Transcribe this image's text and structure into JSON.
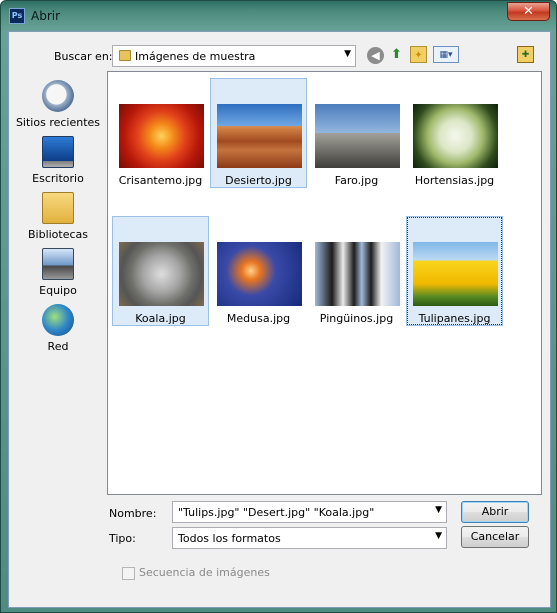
{
  "window": {
    "title": "Abrir",
    "app_icon": "Ps",
    "close_glyph": "✕"
  },
  "toolbar": {
    "lookin_label": "Buscar en:",
    "lookin_value": "Imágenes de muestra",
    "dropdown_glyph": "▼",
    "icons": [
      "back-icon",
      "up-folder-icon",
      "new-folder-icon",
      "view-menu-icon",
      "pin-icon"
    ]
  },
  "places": [
    {
      "label": "Sitios recientes",
      "icon": "recent-places-icon"
    },
    {
      "label": "Escritorio",
      "icon": "desktop-icon"
    },
    {
      "label": "Bibliotecas",
      "icon": "libraries-icon"
    },
    {
      "label": "Equipo",
      "icon": "computer-icon"
    },
    {
      "label": "Red",
      "icon": "network-icon"
    }
  ],
  "files": [
    {
      "name": "Crisantemo.jpg",
      "selected": false
    },
    {
      "name": "Desierto.jpg",
      "selected": true
    },
    {
      "name": "Faro.jpg",
      "selected": false
    },
    {
      "name": "Hortensias.jpg",
      "selected": false
    },
    {
      "name": "Koala.jpg",
      "selected": true
    },
    {
      "name": "Medusa.jpg",
      "selected": false
    },
    {
      "name": "Pingüinos.jpg",
      "selected": false
    },
    {
      "name": "Tulipanes.jpg",
      "selected": true
    }
  ],
  "form": {
    "name_label": "Nombre:",
    "name_value": "\"Tulips.jpg\" \"Desert.jpg\" \"Koala.jpg\"",
    "type_label": "Tipo:",
    "type_value": "Todos los formatos",
    "open_label": "Abrir",
    "cancel_label": "Cancelar",
    "sequence_label": "Secuencia de imágenes",
    "sequence_checked": false
  },
  "colors": {
    "frame": "#4d8a7e",
    "selection": "#ddebf8",
    "selection_border": "#99c1e8",
    "close": "#c0391f"
  }
}
